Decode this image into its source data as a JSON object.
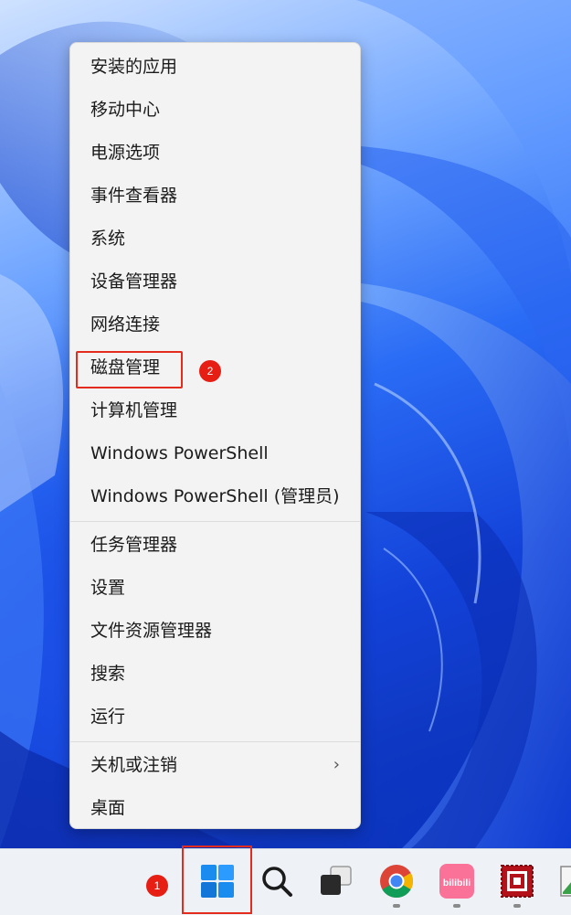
{
  "context_menu": {
    "groups": [
      [
        {
          "label": "安装的应用"
        },
        {
          "label": "移动中心"
        },
        {
          "label": "电源选项"
        },
        {
          "label": "事件查看器"
        },
        {
          "label": "系统"
        },
        {
          "label": "设备管理器"
        },
        {
          "label": "网络连接"
        },
        {
          "label": "磁盘管理",
          "highlighted": true
        },
        {
          "label": "计算机管理"
        },
        {
          "label": "Windows PowerShell"
        },
        {
          "label": "Windows PowerShell (管理员)"
        }
      ],
      [
        {
          "label": "任务管理器"
        },
        {
          "label": "设置"
        },
        {
          "label": "文件资源管理器"
        },
        {
          "label": "搜索"
        },
        {
          "label": "运行"
        }
      ],
      [
        {
          "label": "关机或注销",
          "has_submenu": true,
          "submenu_icon": "chevron-right-icon"
        },
        {
          "label": "桌面"
        }
      ]
    ]
  },
  "annotations": {
    "step_1": "1",
    "step_2": "2",
    "color": "#e32b1e"
  },
  "taskbar": {
    "icons": [
      {
        "name": "windows-start-icon",
        "running": false
      },
      {
        "name": "search-icon",
        "running": false
      },
      {
        "name": "task-view-icon",
        "running": false
      },
      {
        "name": "chrome-icon",
        "running": true
      },
      {
        "name": "bilibili-icon",
        "running": true,
        "text": "bilibili"
      },
      {
        "name": "red-app-icon",
        "running": true
      },
      {
        "name": "image-app-icon",
        "running": false
      }
    ]
  },
  "colors": {
    "menu_bg": "#f3f3f3",
    "taskbar_bg": "#eef1f6",
    "accent_blue": "#1a6fe0"
  }
}
